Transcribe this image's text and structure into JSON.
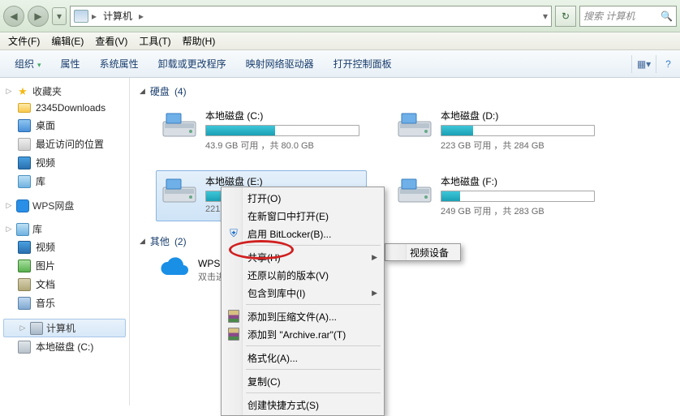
{
  "address": {
    "root_label": "计算机",
    "separator": "▸",
    "refresh_icon": "↻",
    "search_placeholder": "搜索 计算机"
  },
  "menu": {
    "file": "文件(F)",
    "edit": "编辑(E)",
    "view": "查看(V)",
    "tools": "工具(T)",
    "help": "帮助(H)"
  },
  "toolbar": {
    "organize": "组织",
    "properties": "属性",
    "system_properties": "系统属性",
    "uninstall": "卸载或更改程序",
    "map_network": "映射网络驱动器",
    "control_panel": "打开控制面板"
  },
  "sidebar": {
    "favorites": {
      "label": "收藏夹",
      "items": [
        "2345Downloads",
        "桌面",
        "最近访问的位置",
        "视频",
        "库"
      ]
    },
    "wps": {
      "label": "WPS网盘"
    },
    "libraries": {
      "label": "库",
      "items": [
        "视频",
        "图片",
        "文档",
        "音乐"
      ]
    },
    "computer": {
      "label": "计算机",
      "items": [
        "本地磁盘 (C:)"
      ]
    }
  },
  "main": {
    "hdd_section": {
      "label": "硬盘",
      "count": "(4)"
    },
    "drives": [
      {
        "name": "本地磁盘 (C:)",
        "free": "43.9 GB 可用",
        "sep": "，共",
        "total": "80.0 GB",
        "fill_pct": 45
      },
      {
        "name": "本地磁盘 (D:)",
        "free": "223 GB 可用",
        "sep": "，共",
        "total": "284 GB",
        "fill_pct": 21
      },
      {
        "name": "本地磁盘 (E:)",
        "free": "221 GB",
        "sep": "",
        "total": "",
        "fill_pct": 22,
        "selected": true
      },
      {
        "name": "本地磁盘 (F:)",
        "free": "249 GB 可用",
        "sep": "，共",
        "total": "283 GB",
        "fill_pct": 12
      }
    ],
    "other_section": {
      "label": "其他",
      "count": "(2)"
    },
    "other_item": {
      "name": "WPS网",
      "sub": "双击进"
    }
  },
  "context_menu": {
    "open": "打开(O)",
    "new_window": "在新窗口中打开(E)",
    "bitlocker": "启用 BitLocker(B)...",
    "share": "共享(H)",
    "restore": "还原以前的版本(V)",
    "include_lib": "包含到库中(I)",
    "add_archive": "添加到压缩文件(A)...",
    "add_archive_rar": "添加到 \"Archive.rar\"(T)",
    "format": "格式化(A)...",
    "copy": "复制(C)",
    "shortcut": "创建快捷方式(S)"
  },
  "submenu": {
    "video_device": "视频设备"
  }
}
